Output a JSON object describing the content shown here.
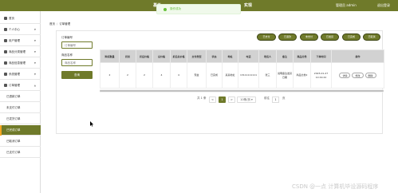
{
  "header": {
    "title_left": "基于",
    "title_right": "实现",
    "user_label": "管理员 admin",
    "logout_label": "退出登录"
  },
  "toast": {
    "message": "操作成功"
  },
  "sidebar": {
    "items": [
      {
        "label": "首页"
      },
      {
        "label": "个人中心"
      },
      {
        "label": "用户管理"
      },
      {
        "label": "商品分类管理"
      },
      {
        "label": "商品信息管理"
      },
      {
        "label": "系统管理"
      },
      {
        "label": "订单管理"
      }
    ],
    "sub_items": [
      {
        "label": "已退款订单"
      },
      {
        "label": "未支付订单"
      },
      {
        "label": "已发货订单"
      },
      {
        "label": "已完成订单"
      },
      {
        "label": "已取消订单"
      },
      {
        "label": "已支付订单"
      }
    ]
  },
  "breadcrumb": {
    "home": "首页",
    "current": "订单管理"
  },
  "search": {
    "order_no_label": "订单编号",
    "order_no_placeholder": "订单编号",
    "goods_name_label": "商品名称",
    "goods_name_placeholder": "商品名称",
    "search_button": "查询"
  },
  "actions": [
    {
      "label": "已支付"
    },
    {
      "label": "已退款"
    },
    {
      "label": "未支付"
    },
    {
      "label": "已发货"
    },
    {
      "label": "已完成"
    },
    {
      "label": "已取消"
    }
  ],
  "table": {
    "headers": [
      "购买数量",
      "折扣",
      "折后价格",
      "总价格",
      "折后总价格",
      "支付类型",
      "状态",
      "地址",
      "电话",
      "收货人",
      "备注",
      "商品分类",
      "下单时间",
      "操作"
    ],
    "rows": [
      {
        "cells": [
          "2",
          "2",
          "2",
          "4",
          "4",
          "现金",
          "已完成",
          "某某地址",
          "13111111111",
          "张三",
          "说明备注发货日期",
          "商品分类2",
          "2023-01-27 10:19:42"
        ],
        "buttons": [
          "详情",
          "修改",
          "删除"
        ]
      }
    ]
  },
  "pagination": {
    "total": "共 1 条",
    "prev": "<",
    "current_page": "1",
    "next": ">",
    "page_size": "10条/页",
    "goto_label": "前往",
    "goto_value": "1",
    "page_suffix": "页"
  },
  "watermark": "CSDN @一点 计算机毕设源码程序",
  "colors": {
    "brand": "#6f7a2a",
    "active_bar": "#f5a623",
    "success": "#67c23a"
  }
}
